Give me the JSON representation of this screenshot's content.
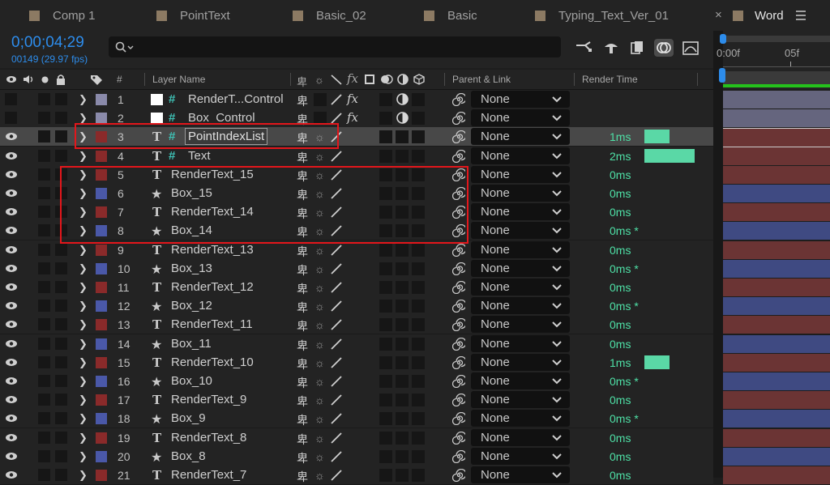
{
  "tabs": [
    {
      "label": "Comp 1",
      "active": false
    },
    {
      "label": "PointText",
      "active": false
    },
    {
      "label": "Basic_02",
      "active": false
    },
    {
      "label": "Basic",
      "active": false
    },
    {
      "label": "Typing_Text_Ver_01",
      "active": false
    },
    {
      "label": "Word",
      "active": true
    }
  ],
  "timecode": "0;00;04;29",
  "fps": "00149 (29.97 fps)",
  "search": {
    "placeholder": "",
    "icon": "search-icon"
  },
  "toolbar_icons": [
    "composition-mini-flowchart-icon",
    "draft-3d-icon",
    "frame-blending-icon",
    "motion-blur-icon",
    "graph-editor-icon"
  ],
  "column_headers": {
    "layer_name": "Layer Name",
    "num": "#",
    "parent": "Parent & Link",
    "render_time": "Render Time"
  },
  "timeline": {
    "start": "0:00f",
    "mark": "05f"
  },
  "colors": {
    "accent": "#2d8ceb",
    "render_time": "#4ee0a6",
    "label_red": "#8a2a2a",
    "label_blue": "#4a58a8",
    "label_lavender": "#8a8aaa",
    "selection_box": "#e3161b"
  },
  "rows": [
    {
      "num": "1",
      "type": "null",
      "name": "RenderT...Control",
      "label": "lavender",
      "eye": false,
      "fx": true,
      "parent": "None",
      "render_time": "",
      "bar": 0
    },
    {
      "num": "2",
      "type": "null",
      "name": "Box_Control",
      "label": "lavender",
      "eye": false,
      "fx": true,
      "parent": "None",
      "render_time": "",
      "bar": 0
    },
    {
      "num": "3",
      "type": "textnull",
      "name": "PointIndexList",
      "label": "red",
      "eye": true,
      "fx": false,
      "parent": "None",
      "render_time": "1ms",
      "bar": 1,
      "selected": true,
      "editing": true
    },
    {
      "num": "4",
      "type": "textnull",
      "name": "Text",
      "label": "red",
      "eye": true,
      "fx": false,
      "parent": "None",
      "render_time": "2ms",
      "bar": 2
    },
    {
      "num": "5",
      "type": "text",
      "name": "RenderText_15",
      "label": "red",
      "eye": true,
      "fx": false,
      "parent": "None",
      "render_time": "0ms",
      "bar": 0
    },
    {
      "num": "6",
      "type": "shape",
      "name": "Box_15",
      "label": "blue",
      "eye": true,
      "fx": false,
      "parent": "None",
      "render_time": "0ms",
      "bar": 0
    },
    {
      "num": "7",
      "type": "text",
      "name": "RenderText_14",
      "label": "red",
      "eye": true,
      "fx": false,
      "parent": "None",
      "render_time": "0ms",
      "bar": 0
    },
    {
      "num": "8",
      "type": "shape",
      "name": "Box_14",
      "label": "blue",
      "eye": true,
      "fx": false,
      "parent": "None",
      "render_time": "0ms *",
      "bar": 0
    },
    {
      "num": "9",
      "type": "text",
      "name": "RenderText_13",
      "label": "red",
      "eye": true,
      "fx": false,
      "parent": "None",
      "render_time": "0ms",
      "bar": 0
    },
    {
      "num": "10",
      "type": "shape",
      "name": "Box_13",
      "label": "blue",
      "eye": true,
      "fx": false,
      "parent": "None",
      "render_time": "0ms *",
      "bar": 0
    },
    {
      "num": "11",
      "type": "text",
      "name": "RenderText_12",
      "label": "red",
      "eye": true,
      "fx": false,
      "parent": "None",
      "render_time": "0ms",
      "bar": 0
    },
    {
      "num": "12",
      "type": "shape",
      "name": "Box_12",
      "label": "blue",
      "eye": true,
      "fx": false,
      "parent": "None",
      "render_time": "0ms *",
      "bar": 0
    },
    {
      "num": "13",
      "type": "text",
      "name": "RenderText_11",
      "label": "red",
      "eye": true,
      "fx": false,
      "parent": "None",
      "render_time": "0ms",
      "bar": 0
    },
    {
      "num": "14",
      "type": "shape",
      "name": "Box_11",
      "label": "blue",
      "eye": true,
      "fx": false,
      "parent": "None",
      "render_time": "0ms",
      "bar": 0
    },
    {
      "num": "15",
      "type": "text",
      "name": "RenderText_10",
      "label": "red",
      "eye": true,
      "fx": false,
      "parent": "None",
      "render_time": "1ms",
      "bar": 1
    },
    {
      "num": "16",
      "type": "shape",
      "name": "Box_10",
      "label": "blue",
      "eye": true,
      "fx": false,
      "parent": "None",
      "render_time": "0ms *",
      "bar": 0
    },
    {
      "num": "17",
      "type": "text",
      "name": "RenderText_9",
      "label": "red",
      "eye": true,
      "fx": false,
      "parent": "None",
      "render_time": "0ms",
      "bar": 0
    },
    {
      "num": "18",
      "type": "shape",
      "name": "Box_9",
      "label": "blue",
      "eye": true,
      "fx": false,
      "parent": "None",
      "render_time": "0ms *",
      "bar": 0
    },
    {
      "num": "19",
      "type": "text",
      "name": "RenderText_8",
      "label": "red",
      "eye": true,
      "fx": false,
      "parent": "None",
      "render_time": "0ms",
      "bar": 0
    },
    {
      "num": "20",
      "type": "shape",
      "name": "Box_8",
      "label": "blue",
      "eye": true,
      "fx": false,
      "parent": "None",
      "render_time": "0ms",
      "bar": 0
    },
    {
      "num": "21",
      "type": "text",
      "name": "RenderText_7",
      "label": "red",
      "eye": true,
      "fx": false,
      "parent": "None",
      "render_time": "0ms",
      "bar": 0
    }
  ]
}
